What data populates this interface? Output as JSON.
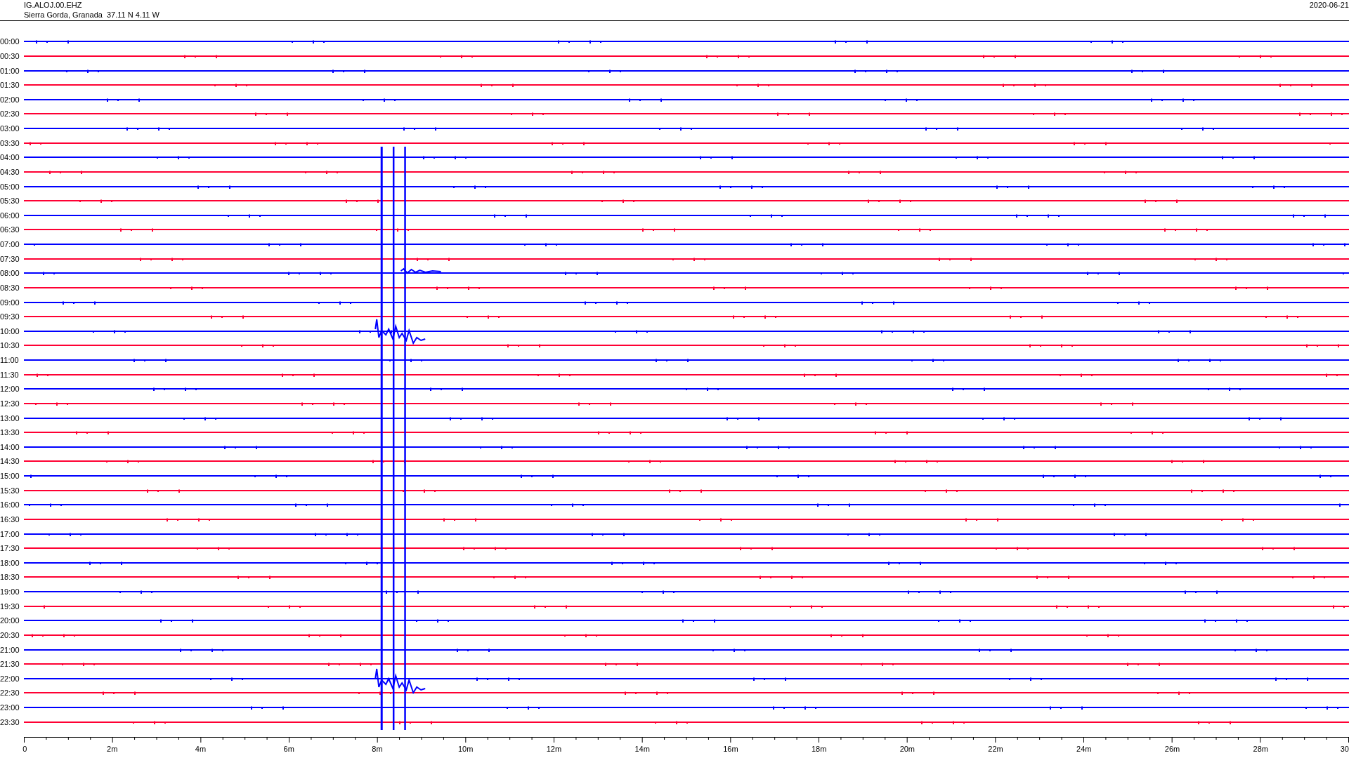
{
  "header": {
    "station": "IG.ALOJ.00.EHZ",
    "location": "Sierra Gorda, Granada  37.11 N 4.11 W",
    "date": "2020-06-21"
  },
  "rows": [
    {
      "label": "00:00",
      "color": "#0000ff"
    },
    {
      "label": "00:30",
      "color": "#ff0033"
    },
    {
      "label": "01:00",
      "color": "#0000ff"
    },
    {
      "label": "01:30",
      "color": "#ff0033"
    },
    {
      "label": "02:00",
      "color": "#0000ff"
    },
    {
      "label": "02:30",
      "color": "#ff0033"
    },
    {
      "label": "03:00",
      "color": "#0000ff"
    },
    {
      "label": "03:30",
      "color": "#ff0033"
    },
    {
      "label": "04:00",
      "color": "#0000ff"
    },
    {
      "label": "04:30",
      "color": "#ff0033"
    },
    {
      "label": "05:00",
      "color": "#0000ff"
    },
    {
      "label": "05:30",
      "color": "#ff0033"
    },
    {
      "label": "06:00",
      "color": "#0000ff"
    },
    {
      "label": "06:30",
      "color": "#ff0033"
    },
    {
      "label": "07:00",
      "color": "#0000ff"
    },
    {
      "label": "07:30",
      "color": "#ff0033"
    },
    {
      "label": "08:00",
      "color": "#0000ff"
    },
    {
      "label": "08:30",
      "color": "#ff0033"
    },
    {
      "label": "09:00",
      "color": "#0000ff"
    },
    {
      "label": "09:30",
      "color": "#ff0033"
    },
    {
      "label": "10:00",
      "color": "#0000ff"
    },
    {
      "label": "10:30",
      "color": "#ff0033"
    },
    {
      "label": "11:00",
      "color": "#0000ff"
    },
    {
      "label": "11:30",
      "color": "#ff0033"
    },
    {
      "label": "12:00",
      "color": "#0000ff"
    },
    {
      "label": "12:30",
      "color": "#ff0033"
    },
    {
      "label": "13:00",
      "color": "#0000ff"
    },
    {
      "label": "13:30",
      "color": "#ff0033"
    },
    {
      "label": "14:00",
      "color": "#0000ff"
    },
    {
      "label": "14:30",
      "color": "#ff0033"
    },
    {
      "label": "15:00",
      "color": "#0000ff"
    },
    {
      "label": "15:30",
      "color": "#ff0033"
    },
    {
      "label": "16:00",
      "color": "#0000ff"
    },
    {
      "label": "16:30",
      "color": "#ff0033"
    },
    {
      "label": "17:00",
      "color": "#0000ff"
    },
    {
      "label": "17:30",
      "color": "#ff0033"
    },
    {
      "label": "18:00",
      "color": "#0000ff"
    },
    {
      "label": "18:30",
      "color": "#ff0033"
    },
    {
      "label": "19:00",
      "color": "#0000ff"
    },
    {
      "label": "19:30",
      "color": "#ff0033"
    },
    {
      "label": "20:00",
      "color": "#0000ff"
    },
    {
      "label": "20:30",
      "color": "#ff0033"
    },
    {
      "label": "21:00",
      "color": "#0000ff"
    },
    {
      "label": "21:30",
      "color": "#ff0033"
    },
    {
      "label": "22:00",
      "color": "#0000ff"
    },
    {
      "label": "22:30",
      "color": "#ff0033"
    },
    {
      "label": "23:00",
      "color": "#0000ff"
    },
    {
      "label": "23:30",
      "color": "#ff0033"
    }
  ],
  "axis": {
    "ticks": [
      "0",
      "2m",
      "4m",
      "6m",
      "8m",
      "10m",
      "12m",
      "14m",
      "16m",
      "18m",
      "20m",
      "22m",
      "24m",
      "26m",
      "28m",
      "30"
    ]
  }
}
